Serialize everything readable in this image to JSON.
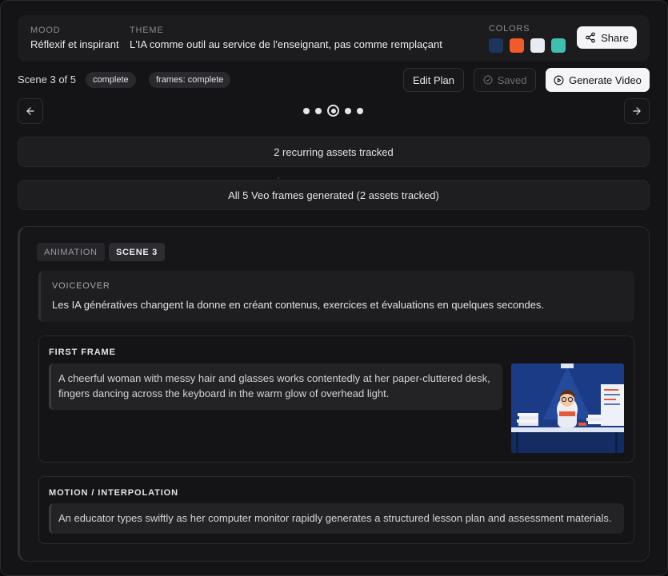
{
  "header": {
    "mood_label": "MOOD",
    "mood_value": "Réflexif et inspirant",
    "theme_label": "THEME",
    "theme_value": "L'IA comme outil au service de l'enseignant, pas comme remplaçant",
    "colors_label": "COLORS",
    "colors": [
      "#1e3560",
      "#f25a2a",
      "#e7ebf2",
      "#3fbfae"
    ],
    "share_label": "Share"
  },
  "status": {
    "scene_count": "Scene 3 of 5",
    "pill_status": "complete",
    "pill_frames": "frames: complete",
    "edit_plan": "Edit Plan",
    "saved": "Saved",
    "generate_video": "Generate Video"
  },
  "pager": {
    "total": 5,
    "current": 3
  },
  "info": {
    "assets": "2 recurring assets tracked",
    "frames": "All 5 Veo frames generated (2 assets tracked)"
  },
  "scene": {
    "tag_type": "ANIMATION",
    "tag_scene": "SCENE 3",
    "voiceover_label": "VOICEOVER",
    "voiceover_text": "Les IA génératives changent la donne en créant contenus, exercices et évaluations en quelques secondes.",
    "first_frame_label": "FIRST FRAME",
    "first_frame_text": "A cheerful woman with messy hair and glasses works contentedly at her paper-cluttered desk, fingers dancing across the keyboard in the warm glow of overhead light.",
    "motion_label": "MOTION / INTERPOLATION",
    "motion_text": "An educator types swiftly as her computer monitor rapidly generates a structured lesson plan and assessment materials."
  }
}
